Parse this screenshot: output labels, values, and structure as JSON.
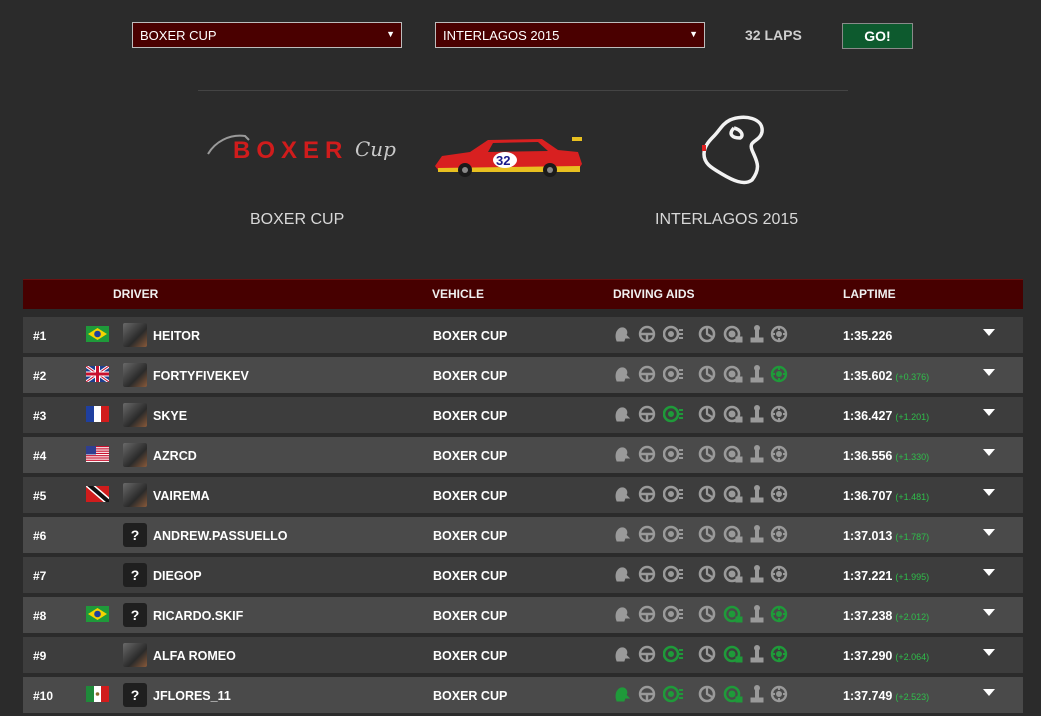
{
  "controls": {
    "series_select": "BOXER CUP",
    "track_select": "INTERLAGOS 2015",
    "laps_label": "32 LAPS",
    "go_label": "GO!"
  },
  "summary": {
    "series_caption": "BOXER CUP",
    "series_logo_text": "BOXER",
    "series_logo_script": "Cup",
    "car_number": "32",
    "track_caption": "INTERLAGOS 2015"
  },
  "table": {
    "headers": {
      "driver": "DRIVER",
      "vehicle": "VEHICLE",
      "aids": "DRIVING AIDS",
      "laptime": "LAPTIME"
    },
    "aid_icons": [
      "clutch-icon",
      "steering-icon",
      "abs-icon",
      "tc-icon",
      "stability-icon",
      "gearbox-icon",
      "brake-line-icon"
    ],
    "rows": [
      {
        "pos": "#1",
        "flag": "brazil",
        "avatar": "photo",
        "name": "HEITOR",
        "vehicle": "BOXER CUP",
        "laptime": "1:35.226",
        "gap": "",
        "aids_active": [
          0,
          0,
          0,
          0,
          0,
          0,
          0
        ]
      },
      {
        "pos": "#2",
        "flag": "uk",
        "avatar": "photo",
        "name": "FORTYFIVEKEV",
        "vehicle": "BOXER CUP",
        "laptime": "1:35.602",
        "gap": "(+0.376)",
        "aids_active": [
          0,
          0,
          0,
          0,
          0,
          0,
          1
        ]
      },
      {
        "pos": "#3",
        "flag": "france",
        "avatar": "photo",
        "name": "SKYE",
        "vehicle": "BOXER CUP",
        "laptime": "1:36.427",
        "gap": "(+1.201)",
        "aids_active": [
          0,
          0,
          1,
          0,
          0,
          0,
          0
        ]
      },
      {
        "pos": "#4",
        "flag": "usa",
        "avatar": "photo",
        "name": "AZRCD",
        "vehicle": "BOXER CUP",
        "laptime": "1:36.556",
        "gap": "(+1.330)",
        "aids_active": [
          0,
          0,
          0,
          0,
          0,
          0,
          0
        ]
      },
      {
        "pos": "#5",
        "flag": "trinidad",
        "avatar": "photo",
        "name": "VAIREMA",
        "vehicle": "BOXER CUP",
        "laptime": "1:36.707",
        "gap": "(+1.481)",
        "aids_active": [
          0,
          0,
          0,
          0,
          0,
          0,
          0
        ]
      },
      {
        "pos": "#6",
        "flag": "",
        "avatar": "unknown",
        "name": "ANDREW.PASSUELLO",
        "vehicle": "BOXER CUP",
        "laptime": "1:37.013",
        "gap": "(+1.787)",
        "aids_active": [
          0,
          0,
          0,
          0,
          0,
          0,
          0
        ]
      },
      {
        "pos": "#7",
        "flag": "",
        "avatar": "unknown",
        "name": "DIEGOP",
        "vehicle": "BOXER CUP",
        "laptime": "1:37.221",
        "gap": "(+1.995)",
        "aids_active": [
          0,
          0,
          0,
          0,
          0,
          0,
          0
        ]
      },
      {
        "pos": "#8",
        "flag": "brazil",
        "avatar": "unknown",
        "name": "RICARDO.SKIF",
        "vehicle": "BOXER CUP",
        "laptime": "1:37.238",
        "gap": "(+2.012)",
        "aids_active": [
          0,
          0,
          0,
          0,
          1,
          0,
          1
        ]
      },
      {
        "pos": "#9",
        "flag": "",
        "avatar": "photo",
        "name": "ALFA ROMEO",
        "vehicle": "BOXER CUP",
        "laptime": "1:37.290",
        "gap": "(+2.064)",
        "aids_active": [
          0,
          0,
          1,
          0,
          1,
          0,
          1
        ]
      },
      {
        "pos": "#10",
        "flag": "mexico",
        "avatar": "unknown",
        "name": "JFLORES_11",
        "vehicle": "BOXER CUP",
        "laptime": "1:37.749",
        "gap": "(+2.523)",
        "aids_active": [
          1,
          0,
          1,
          0,
          1,
          0,
          0
        ]
      }
    ]
  },
  "colors": {
    "aid_active": "#1f9a3a",
    "aid_inactive": "#9a9a9a",
    "header_bg": "#470000",
    "go_bg": "#0d5a2e"
  }
}
